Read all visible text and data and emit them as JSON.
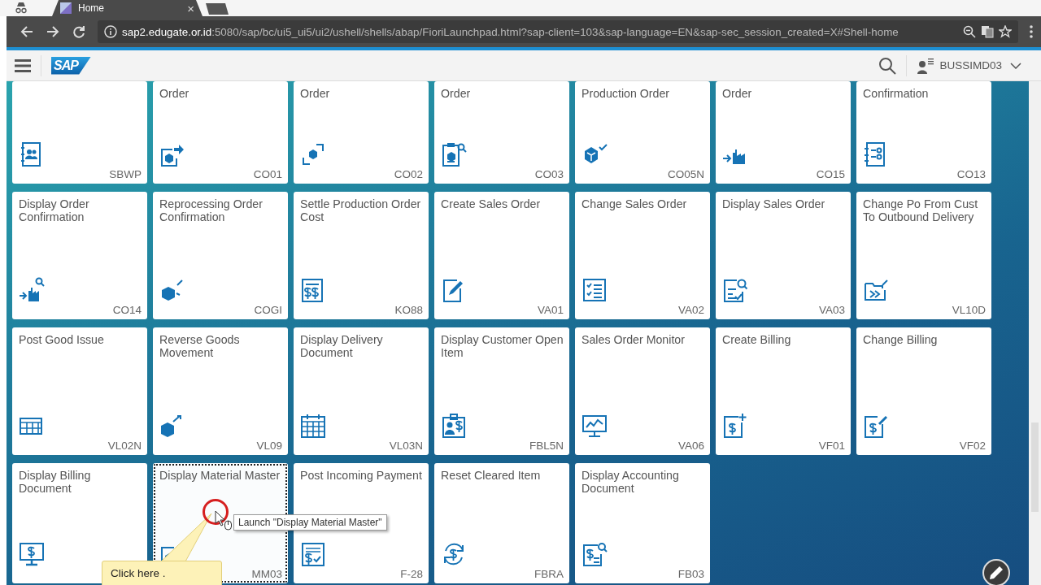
{
  "browser": {
    "tab": {
      "title": "Home",
      "close": "×"
    },
    "url": {
      "host": "sap2.edugate.or.id",
      "rest": ":5080/sap/bc/ui5_ui5/ui2/ushell/shells/abap/FioriLaunchpad.html?sap-client=103&sap-language=EN&sap-sec_session_created=X#Shell-home"
    }
  },
  "shell": {
    "logo": "SAP",
    "user": "BUSSIMD03"
  },
  "tiles": [
    {
      "code": "SBWP",
      "focused": false
    },
    {
      "title": "Order",
      "code": "CO01",
      "focused": false
    },
    {
      "title": "Order",
      "code": "CO02",
      "focused": false
    },
    {
      "title": "Order",
      "code": "CO03",
      "focused": false
    },
    {
      "title": "Production Order",
      "code": "CO05N",
      "focused": false
    },
    {
      "title": "Order",
      "code": "CO15",
      "focused": false
    },
    {
      "title": "Confirmation",
      "code": "CO13",
      "focused": false
    },
    {
      "title": "Display Order Confirmation",
      "code": "CO14",
      "focused": false
    },
    {
      "title": "Reprocessing Order Confirmation",
      "code": "COGI",
      "focused": false
    },
    {
      "title": "Settle Production Order Cost",
      "code": "KO88",
      "focused": false
    },
    {
      "title": "Create Sales Order",
      "code": "VA01",
      "focused": false
    },
    {
      "title": "Change Sales Order",
      "code": "VA02",
      "focused": false
    },
    {
      "title": "Display Sales Order",
      "code": "VA03",
      "focused": false
    },
    {
      "title": "Change Po From Cust To Outbound Delivery",
      "code": "VL10D",
      "focused": false
    },
    {
      "title": "Post Good Issue",
      "code": "VL02N",
      "focused": false
    },
    {
      "title": "Reverse Goods Movement",
      "code": "VL09",
      "focused": false
    },
    {
      "title": "Display Delivery Document",
      "code": "VL03N",
      "focused": false
    },
    {
      "title": "Display Customer Open Item",
      "code": "FBL5N",
      "focused": false
    },
    {
      "title": "Sales Order Monitor",
      "code": "VA06",
      "focused": false
    },
    {
      "title": "Create Billing",
      "code": "VF01",
      "focused": false
    },
    {
      "title": "Change Billing",
      "code": "VF02",
      "focused": false
    },
    {
      "title": "Display Billing Document",
      "focused": false
    },
    {
      "title": "Display Material Master",
      "code": "MM03",
      "focused": true
    },
    {
      "title": "Post Incoming Payment",
      "code": "F-28",
      "focused": false
    },
    {
      "title": "Reset Cleared Item",
      "code": "FBRA",
      "focused": false
    },
    {
      "title": "Display Accounting Document",
      "code": "FB03",
      "focused": false
    }
  ],
  "tooltip": "Launch \"Display Material Master\"",
  "callout": "Click here ."
}
